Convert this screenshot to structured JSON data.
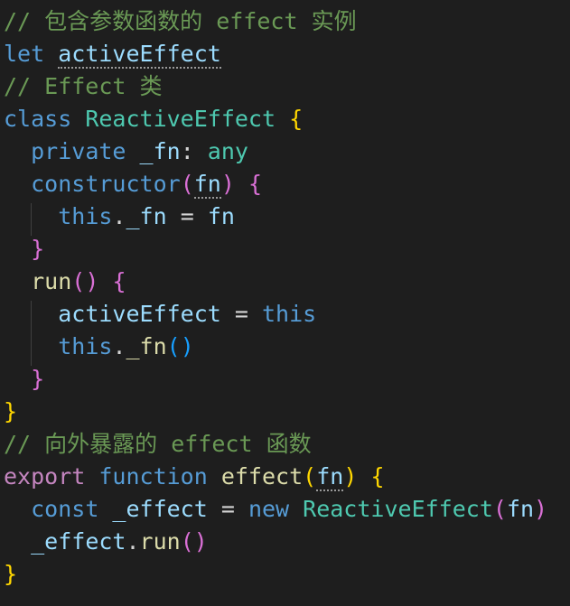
{
  "editor": {
    "theme_background": "#1e1e1e",
    "lines": [
      {
        "tokens": [
          {
            "text": "// 包含参数函数的 effect 实例",
            "color": "#6a9955"
          }
        ]
      },
      {
        "tokens": [
          {
            "text": "let ",
            "color": "#569cd6"
          },
          {
            "text": "activeEffect",
            "color": "#9cdcfe",
            "squiggle": true
          }
        ]
      },
      {
        "tokens": [
          {
            "text": "// Effect 类",
            "color": "#6a9955"
          }
        ]
      },
      {
        "tokens": [
          {
            "text": "class ",
            "color": "#569cd6"
          },
          {
            "text": "ReactiveEffect",
            "color": "#4ec9b0"
          },
          {
            "text": " ",
            "color": "#d4d4d4"
          },
          {
            "text": "{",
            "color": "#ffd700"
          }
        ]
      },
      {
        "tokens": [
          {
            "text": "  ",
            "color": "#d4d4d4"
          },
          {
            "text": "private ",
            "color": "#569cd6"
          },
          {
            "text": "_fn",
            "color": "#9cdcfe"
          },
          {
            "text": ": ",
            "color": "#d4d4d4"
          },
          {
            "text": "any",
            "color": "#4ec9b0"
          }
        ]
      },
      {
        "tokens": [
          {
            "text": "  ",
            "color": "#d4d4d4"
          },
          {
            "text": "constructor",
            "color": "#569cd6"
          },
          {
            "text": "(",
            "color": "#da70d6"
          },
          {
            "text": "fn",
            "color": "#9cdcfe",
            "squiggle": true
          },
          {
            "text": ")",
            "color": "#da70d6"
          },
          {
            "text": " ",
            "color": "#d4d4d4"
          },
          {
            "text": "{",
            "color": "#da70d6"
          }
        ]
      },
      {
        "tokens": [
          {
            "text": "    ",
            "color": "#d4d4d4"
          },
          {
            "text": "this",
            "color": "#569cd6"
          },
          {
            "text": ".",
            "color": "#d4d4d4"
          },
          {
            "text": "_fn",
            "color": "#9cdcfe"
          },
          {
            "text": " = ",
            "color": "#d4d4d4"
          },
          {
            "text": "fn",
            "color": "#9cdcfe"
          }
        ]
      },
      {
        "tokens": [
          {
            "text": "  ",
            "color": "#d4d4d4"
          },
          {
            "text": "}",
            "color": "#da70d6"
          }
        ]
      },
      {
        "tokens": [
          {
            "text": "  ",
            "color": "#d4d4d4"
          },
          {
            "text": "run",
            "color": "#dcdcaa"
          },
          {
            "text": "()",
            "color": "#da70d6"
          },
          {
            "text": " ",
            "color": "#d4d4d4"
          },
          {
            "text": "{",
            "color": "#da70d6"
          }
        ]
      },
      {
        "tokens": [
          {
            "text": "    ",
            "color": "#d4d4d4"
          },
          {
            "text": "activeEffect",
            "color": "#9cdcfe"
          },
          {
            "text": " = ",
            "color": "#d4d4d4"
          },
          {
            "text": "this",
            "color": "#569cd6"
          }
        ]
      },
      {
        "tokens": [
          {
            "text": "    ",
            "color": "#d4d4d4"
          },
          {
            "text": "this",
            "color": "#569cd6"
          },
          {
            "text": ".",
            "color": "#d4d4d4"
          },
          {
            "text": "_fn",
            "color": "#dcdcaa"
          },
          {
            "text": "()",
            "color": "#179fff"
          }
        ]
      },
      {
        "tokens": [
          {
            "text": "  ",
            "color": "#d4d4d4"
          },
          {
            "text": "}",
            "color": "#da70d6"
          }
        ]
      },
      {
        "tokens": [
          {
            "text": "}",
            "color": "#ffd700"
          }
        ]
      },
      {
        "tokens": [
          {
            "text": "// 向外暴露的 effect 函数",
            "color": "#6a9955"
          }
        ]
      },
      {
        "tokens": [
          {
            "text": "export ",
            "color": "#c586c0"
          },
          {
            "text": "function ",
            "color": "#569cd6"
          },
          {
            "text": "effect",
            "color": "#dcdcaa"
          },
          {
            "text": "(",
            "color": "#ffd700"
          },
          {
            "text": "fn",
            "color": "#9cdcfe",
            "squiggle": true
          },
          {
            "text": ")",
            "color": "#ffd700"
          },
          {
            "text": " ",
            "color": "#d4d4d4"
          },
          {
            "text": "{",
            "color": "#ffd700"
          }
        ]
      },
      {
        "tokens": [
          {
            "text": "  ",
            "color": "#d4d4d4"
          },
          {
            "text": "const ",
            "color": "#569cd6"
          },
          {
            "text": "_effect",
            "color": "#9cdcfe"
          },
          {
            "text": " = ",
            "color": "#d4d4d4"
          },
          {
            "text": "new ",
            "color": "#569cd6"
          },
          {
            "text": "ReactiveEffect",
            "color": "#4ec9b0"
          },
          {
            "text": "(",
            "color": "#da70d6"
          },
          {
            "text": "fn",
            "color": "#9cdcfe"
          },
          {
            "text": ")",
            "color": "#da70d6"
          }
        ]
      },
      {
        "tokens": [
          {
            "text": "  ",
            "color": "#d4d4d4"
          },
          {
            "text": "_effect",
            "color": "#9cdcfe"
          },
          {
            "text": ".",
            "color": "#d4d4d4"
          },
          {
            "text": "run",
            "color": "#dcdcaa"
          },
          {
            "text": "()",
            "color": "#da70d6"
          }
        ]
      },
      {
        "tokens": [
          {
            "text": "}",
            "color": "#ffd700"
          }
        ]
      }
    ]
  }
}
